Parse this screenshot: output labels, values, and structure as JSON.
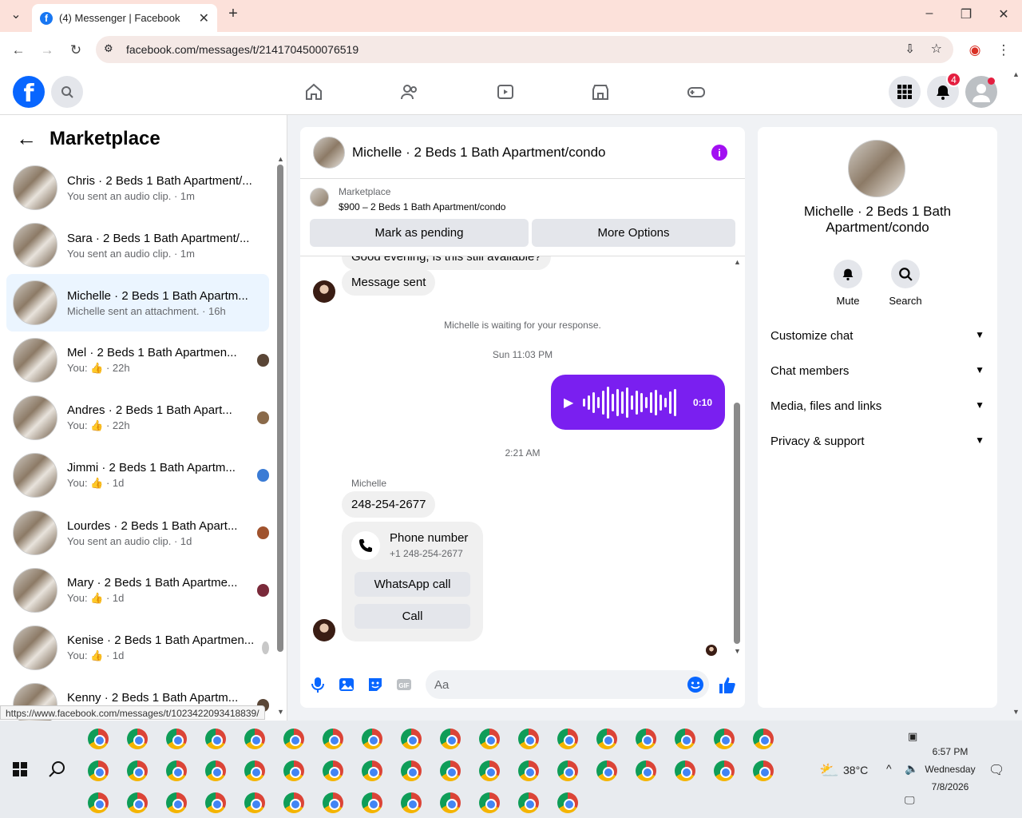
{
  "browser": {
    "tab_title": "(4) Messenger | Facebook",
    "url": "facebook.com/messages/t/2141704500076519",
    "status_url": "https://www.facebook.com/messages/t/1023422093418839/"
  },
  "fb": {
    "notif_count": "4"
  },
  "sidebar": {
    "title": "Marketplace",
    "items": [
      {
        "name": "Chris · 2 Beds 1 Bath Apartment/...",
        "sub": "You sent an audio clip. · 1m"
      },
      {
        "name": "Sara · 2 Beds 1 Bath Apartment/...",
        "sub": "You sent an audio clip. · 1m"
      },
      {
        "name": "Michelle · 2 Beds 1 Bath Apartm...",
        "sub": "Michelle sent an attachment. · 16h"
      },
      {
        "name": "Mel · 2 Beds 1 Bath Apartmen...",
        "sub": "You: 👍 · 22h"
      },
      {
        "name": "Andres · 2 Beds 1 Bath Apart...",
        "sub": "You: 👍 · 22h"
      },
      {
        "name": "Jimmi · 2 Beds 1 Bath Apartm...",
        "sub": "You: 👍 · 1d"
      },
      {
        "name": "Lourdes · 2 Beds 1 Bath Apart...",
        "sub": "You sent an audio clip. · 1d"
      },
      {
        "name": "Mary · 2 Beds 1 Bath Apartme...",
        "sub": "You: 👍 · 1d"
      },
      {
        "name": "Kenise · 2 Beds 1 Bath Apartmen...",
        "sub": "You: 👍 · 1d"
      },
      {
        "name": "Kenny · 2 Beds 1 Bath Apartm...",
        "sub": "You: 👍 · 1d"
      }
    ]
  },
  "chat": {
    "title": "Michelle · 2 Beds 1 Bath Apartment/condo",
    "mkt_label": "Marketplace",
    "mkt_listing": "$900 – 2 Beds 1 Bath Apartment/condo",
    "btn_pending": "Mark as pending",
    "btn_more": "More Options",
    "partial_msg": "Good evening, is this still available?",
    "msg_sent": "Message sent",
    "waiting": "Michelle is waiting for your response.",
    "time1": "Sun 11:03 PM",
    "audio_duration": "0:10",
    "time2": "2:21 AM",
    "sender": "Michelle",
    "phone_msg": "248-254-2677",
    "card_title": "Phone number",
    "card_sub": "+1 248-254-2677",
    "btn_whatsapp": "WhatsApp call",
    "btn_call": "Call",
    "input_placeholder": "Aa"
  },
  "info_panel": {
    "name": "Michelle · 2 Beds 1 Bath Apartment/condo",
    "mute": "Mute",
    "search": "Search",
    "rows": [
      "Customize chat",
      "Chat members",
      "Media, files and links",
      "Privacy & support"
    ]
  },
  "taskbar": {
    "temp": "38°C",
    "time": "6:57 PM",
    "day": "Wednesday",
    "date": "7/8/2026"
  }
}
